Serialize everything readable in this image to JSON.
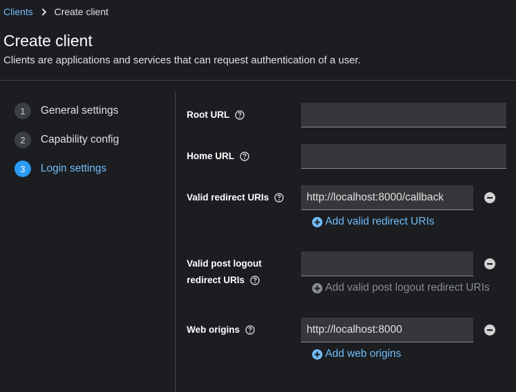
{
  "breadcrumb": {
    "parent": "Clients",
    "current": "Create client"
  },
  "header": {
    "title": "Create client",
    "description": "Clients are applications and services that can request authentication of a user."
  },
  "wizard": {
    "steps": [
      {
        "number": "1",
        "label": "General settings",
        "active": false
      },
      {
        "number": "2",
        "label": "Capability config",
        "active": false
      },
      {
        "number": "3",
        "label": "Login settings",
        "active": true
      }
    ]
  },
  "form": {
    "root_url": {
      "label": "Root URL",
      "value": ""
    },
    "home_url": {
      "label": "Home URL",
      "value": ""
    },
    "valid_redirect_uris": {
      "label": "Valid redirect URIs",
      "value": "http://localhost:8000/callback",
      "add_label": "Add valid redirect URIs"
    },
    "valid_post_logout": {
      "label_line1": "Valid post logout",
      "label_line2": "redirect URIs",
      "value": "",
      "add_label": "Add valid post logout redirect URIs"
    },
    "web_origins": {
      "label": "Web origins",
      "value": "http://localhost:8000",
      "add_label": "Add web origins"
    }
  },
  "colors": {
    "background": "#1b1d21",
    "accent": "#73bcf7",
    "active_step": "#2b9af3",
    "input_bg": "#36373a"
  },
  "icons": {
    "breadcrumb_separator": "chevron-right-icon",
    "help": "question-circle-icon",
    "remove": "minus-circle-icon",
    "add": "plus-circle-icon"
  }
}
